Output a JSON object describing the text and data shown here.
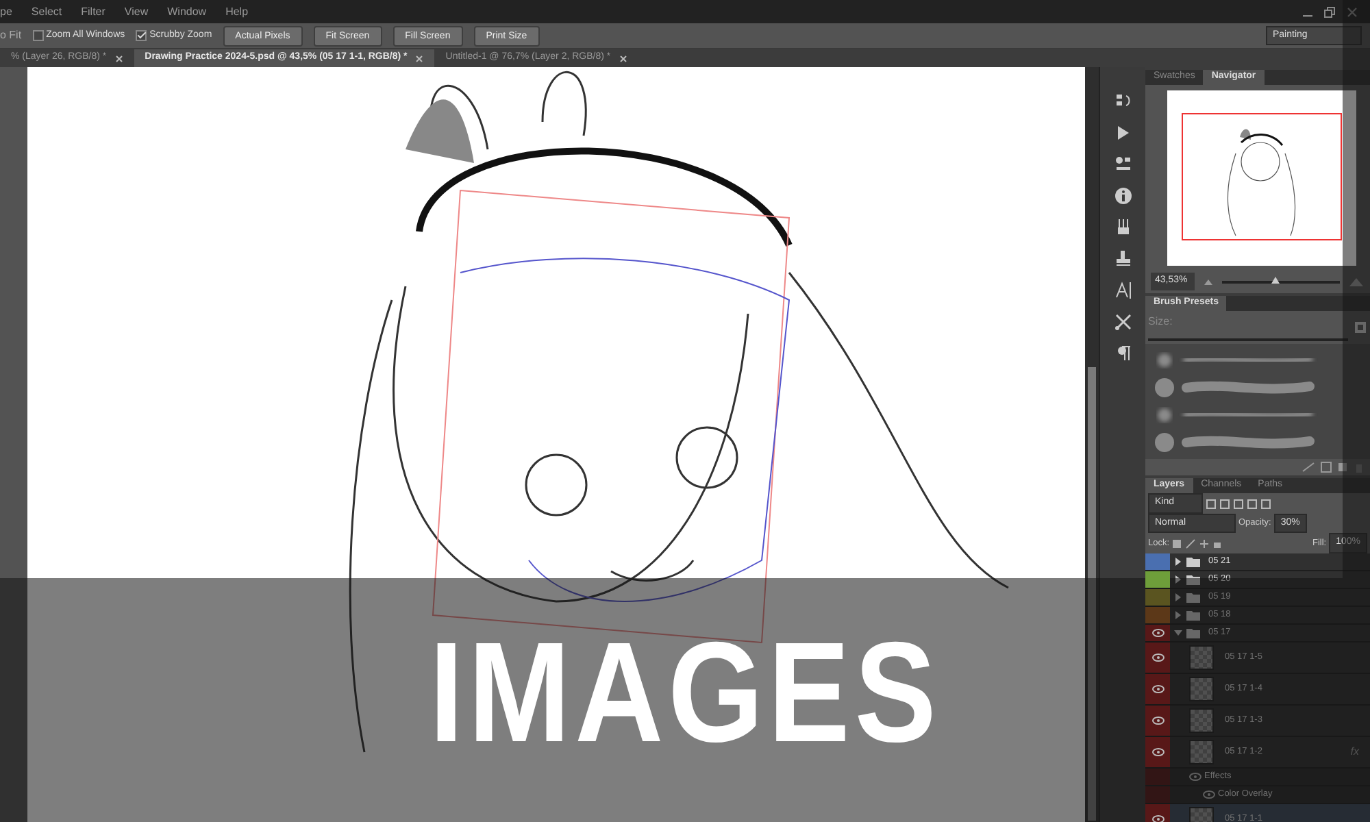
{
  "menu_bar": [
    "pe",
    "Select",
    "Filter",
    "View",
    "Window",
    "Help"
  ],
  "options_bar": {
    "cut_label": "o Fit",
    "checkboxes": [
      {
        "label": "Zoom All Windows",
        "checked": false
      },
      {
        "label": "Scrubby Zoom",
        "checked": true
      }
    ],
    "buttons": [
      "Actual Pixels",
      "Fit Screen",
      "Fill Screen",
      "Print Size"
    ],
    "workspace": "Painting"
  },
  "document_tabs": [
    {
      "label": "% (Layer 26, RGB/8) *",
      "selected": false
    },
    {
      "label": "Drawing Practice 2024-5.psd @ 43,5% (05 17 1-1, RGB/8) *",
      "selected": true
    },
    {
      "label": "Untitled-1 @ 76,7% (Layer 2, RGB/8) *",
      "selected": false
    }
  ],
  "panel_tabs": [
    {
      "label": "Swatches",
      "selected": false
    },
    {
      "label": "Navigator",
      "selected": true
    }
  ],
  "navigator": {
    "zoom": "43,53%",
    "level": 0.45
  },
  "brush_presets": {
    "title": "Brush Presets",
    "size_label": "Size:",
    "brushes": [
      {
        "kind": "soft"
      },
      {
        "kind": "hard"
      },
      {
        "kind": "soft"
      },
      {
        "kind": "hard"
      }
    ]
  },
  "layer_tabs": [
    {
      "label": "Layers",
      "selected": true
    },
    {
      "label": "Channels",
      "selected": false
    },
    {
      "label": "Paths",
      "selected": false
    }
  ],
  "layer_filter": "Kind",
  "blend_mode": "Normal",
  "opacity_label": "Opacity:",
  "opacity": "30%",
  "lock_label": "Lock:",
  "fill_label": "Fill:",
  "fill": "100%",
  "layers": [
    {
      "kind": "group",
      "name": "05 21",
      "color": "#4a6fb0",
      "visible": false,
      "expanded": false,
      "selected": false
    },
    {
      "kind": "group",
      "name": "05 20",
      "color": "#6e9e3a",
      "visible": false,
      "expanded": false,
      "selected": false
    },
    {
      "kind": "group",
      "name": "05 19",
      "color": "#5a5420",
      "visible": false,
      "expanded": false,
      "selected": false
    },
    {
      "kind": "group",
      "name": "05 18",
      "color": "#5c3818",
      "visible": false,
      "expanded": false,
      "selected": false
    },
    {
      "kind": "group",
      "name": "05 17",
      "color": "#581818",
      "visible": true,
      "expanded": true,
      "selected": false,
      "children": [
        {
          "kind": "layer",
          "name": "05 17 1-5",
          "color": "#581818",
          "visible": true,
          "selected": false
        },
        {
          "kind": "layer",
          "name": "05 17 1-4",
          "color": "#581818",
          "visible": true,
          "selected": false
        },
        {
          "kind": "layer",
          "name": "05 17 1-3",
          "color": "#581818",
          "visible": true,
          "selected": false
        },
        {
          "kind": "layer",
          "name": "05 17 1-2",
          "color": "#581818",
          "visible": true,
          "selected": false,
          "fx": "fx",
          "effects": {
            "label": "Effects",
            "children": [
              {
                "label": "Color Overlay"
              }
            ]
          }
        },
        {
          "kind": "layer",
          "name": "05 17 1-1",
          "color": "#581818",
          "visible": true,
          "selected": true
        }
      ]
    }
  ],
  "overlay": {
    "title": "IMAGES"
  }
}
